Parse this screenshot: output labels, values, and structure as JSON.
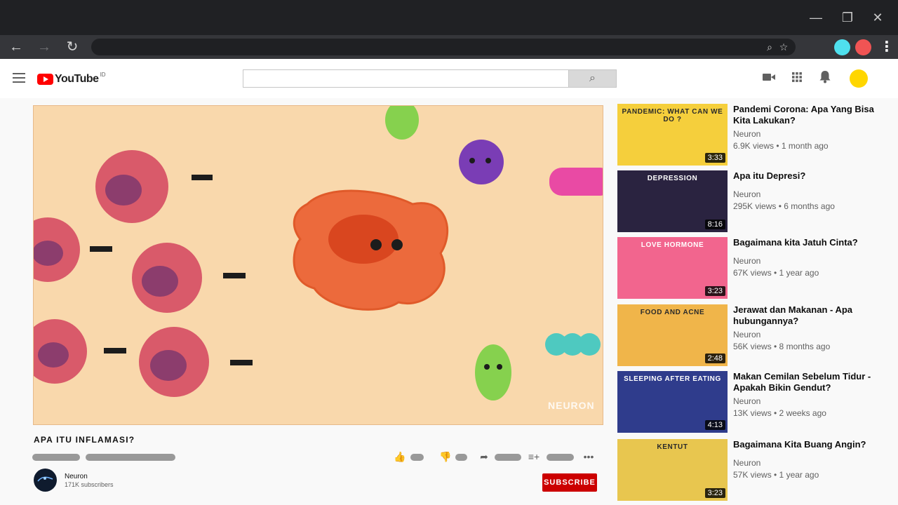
{
  "window_controls": {
    "minimize": "—",
    "restore": "❐",
    "close": "✕"
  },
  "browser": {
    "back": "←",
    "forward": "→",
    "reload": "↻",
    "search_glyph": "⌕",
    "star_glyph": "☆",
    "ext_colors": [
      "#4fe0ee",
      "#f05454"
    ]
  },
  "header": {
    "logo_text": "YouTube",
    "country_code": "ID",
    "search_value": "",
    "search_glyph": "⌕",
    "icons": {
      "camera": "■",
      "apps": "⋮⋮",
      "bell": "🔔"
    }
  },
  "video": {
    "title": "APA ITU INFLAMASI?",
    "channel_name": "Neuron",
    "channel_subs": "171K subscribers",
    "subscribe_label": "SUBSCRIBE",
    "watermark": "NEURON",
    "actions": {
      "like": "👍",
      "dislike": "👎",
      "share": "➦",
      "save": "≡+",
      "more": "•••"
    }
  },
  "recommendations": [
    {
      "title": "Pandemi Corona: Apa Yang Bisa Kita Lakukan?",
      "channel": "Neuron",
      "meta": "6.9K views • 1 month ago",
      "duration": "3:33",
      "thumb_text": "PANDEMIC: WHAT CAN WE DO ?",
      "thumb_bg": "#f5cf3c"
    },
    {
      "title": "Apa itu Depresi?",
      "channel": "Neuron",
      "meta": "295K views • 6 months ago",
      "duration": "8:16",
      "thumb_text": "DEPRESSION",
      "thumb_bg": "#2a2340"
    },
    {
      "title": "Bagaimana kita Jatuh Cinta?",
      "channel": "Neuron",
      "meta": "67K views • 1 year ago",
      "duration": "3:23",
      "thumb_text": "LOVE HORMONE",
      "thumb_bg": "#f2658e"
    },
    {
      "title": "Jerawat dan Makanan - Apa hubungannya?",
      "channel": "Neuron",
      "meta": "56K views • 8 months ago",
      "duration": "2:48",
      "thumb_text": "FOOD AND ACNE",
      "thumb_bg": "#f0b54a"
    },
    {
      "title": "Makan Cemilan Sebelum Tidur - Apakah Bikin Gendut?",
      "channel": "Neuron",
      "meta": "13K views • 2 weeks ago",
      "duration": "4:13",
      "thumb_text": "SLEEPING AFTER EATING",
      "thumb_bg": "#2f3c8c"
    },
    {
      "title": "Bagaimana Kita Buang Angin?",
      "channel": "Neuron",
      "meta": "57K views • 1 year ago",
      "duration": "3:23",
      "thumb_text": "KENTUT",
      "thumb_bg": "#e8c64f"
    }
  ]
}
